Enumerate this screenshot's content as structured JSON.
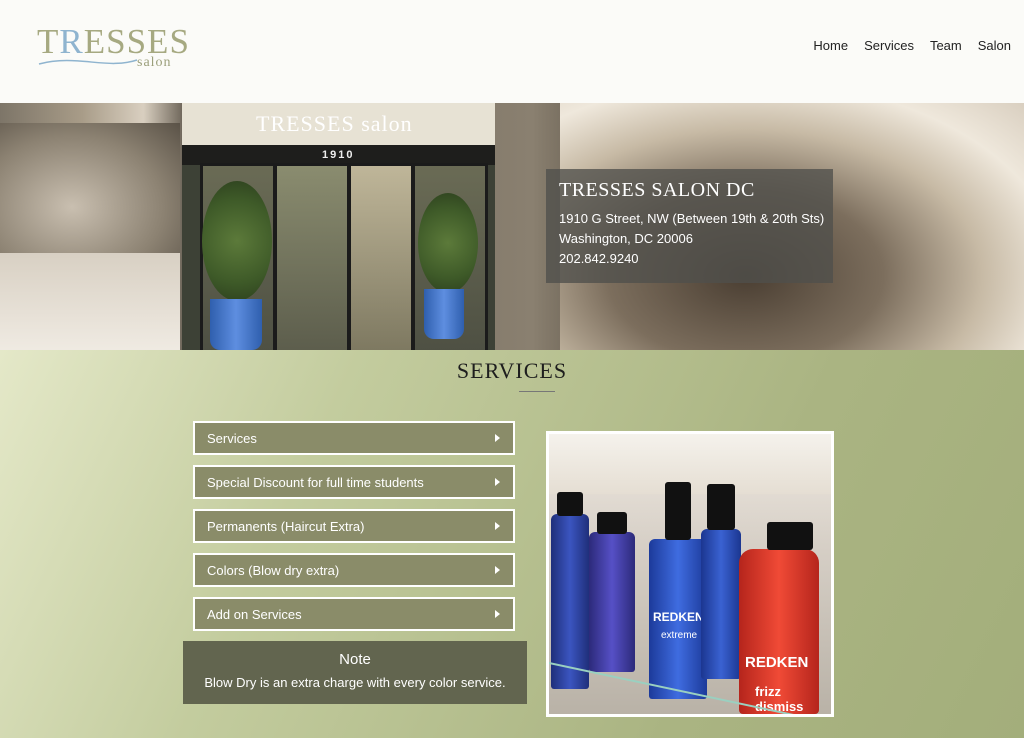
{
  "header": {
    "logo_text_a": "T",
    "logo_text_r": "R",
    "logo_text_b": "ESSES",
    "logo_sub": "salon",
    "nav": [
      "Home",
      "Services",
      "Team",
      "Salon"
    ]
  },
  "hero": {
    "awning_text": "TRESSES salon",
    "address_number": "1910",
    "contact": {
      "title": "TRESSES SALON DC",
      "line1": "1910 G Street, NW (Between 19th & 20th Sts)",
      "line2": "Washington, DC 20006",
      "phone": "202.842.9240"
    }
  },
  "services": {
    "heading": "SERVICES",
    "accordion": [
      "Services",
      "Special Discount for full time students",
      "Permanents (Haircut Extra)",
      "Colors (Blow dry extra)",
      "Add on Services"
    ],
    "note_title": "Note",
    "note_text": "Blow Dry is an extra charge with every color service."
  },
  "photo": {
    "brand": "REDKEN",
    "brand2": "REDKEN",
    "product1": "extreme",
    "product2": "frizz dismiss"
  },
  "colors": {
    "accent_olive": "#8a8c69",
    "note_bg": "#62654f",
    "contact_bg": "#50504c"
  }
}
